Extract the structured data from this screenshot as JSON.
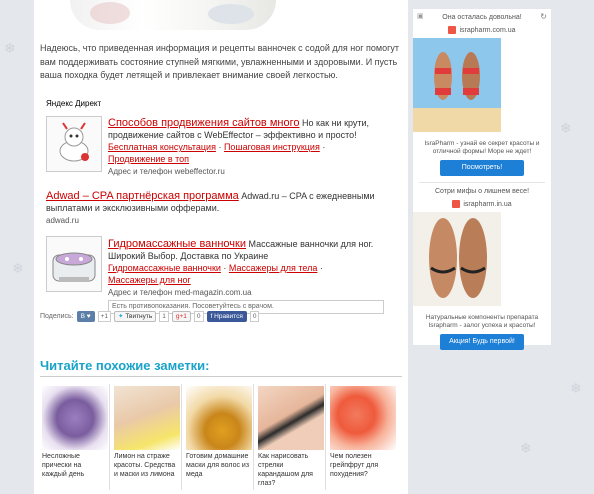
{
  "intro_text": "Надеюсь, что приведенная информация и рецепты ванночек с содой для ног помогут вам поддерживать состояние ступней мягкими, увлажненными и здоровыми. И пусть ваша походка будет летящей и привлекает внимание своей легкостью.",
  "direct_label": "Яндекс Директ",
  "ads": [
    {
      "title": "Способов продвижения сайтов много",
      "desc": " Но как ни крути, продвижение сайтов с WebEffector – эффективно и просто!",
      "links": [
        "Бесплатная консультация",
        "Пошаговая инструкция",
        "Продвижение в топ"
      ],
      "addr": "Адрес и телефон",
      "domain": "webeffector.ru"
    },
    {
      "title": "Adwad – CPA партнёрская программа",
      "desc": " Adwad.ru – CPA с ежедневными выплатами и эксклюзивными офферами.",
      "domain": "adwad.ru"
    },
    {
      "title": "Гидромассажные ванночки",
      "desc": " Массажные ванночки для ног. Широкий Выбор. Доставка по Украине",
      "links": [
        "Гидромассажные ванночки",
        "Массажеры для тела",
        "Массажеры для ног"
      ],
      "addr": "Адрес и телефон",
      "domain": "med-magazin.com.ua",
      "warning": "Есть противопоказания. Посоветуйтесь с врачом."
    }
  ],
  "share": {
    "label": "Поделись:",
    "vk": "В",
    "vk_heart": "♥",
    "plus_one": "+1",
    "tweet": "Твитнуть",
    "tweet_count": "1",
    "gplus": "g+1",
    "gplus_count": "0",
    "fb": "Нравится",
    "fb_count": "0"
  },
  "related": {
    "title": "Читайте похожие заметки:",
    "items": [
      {
        "caption": "Несложные прически на каждый день"
      },
      {
        "caption": "Лимон на страже красоты. Средства и маски из лимона"
      },
      {
        "caption": "Готовим домашние маски для волос из меда"
      },
      {
        "caption": "Как нарисовать стрелки карандашом для глаз?"
      },
      {
        "caption": "Чем полезен грейпфрут для похудения?"
      }
    ]
  },
  "sidebar": {
    "blocks": [
      {
        "head": "Она осталась довольна!",
        "domain": "israpharm.com.ua",
        "text": "IsraPharm - узнай ее секрет красоты и отличной формы! Море не ждет!",
        "button": "Посмотреть!"
      },
      {
        "head": "Сотри мифы о лишнем весе!",
        "domain": "israpharm.in.ua",
        "text": "Натуральные компоненты препарата Israpharm - залог успеха и красоты!",
        "button": "Акция! Будь первой!"
      }
    ]
  }
}
